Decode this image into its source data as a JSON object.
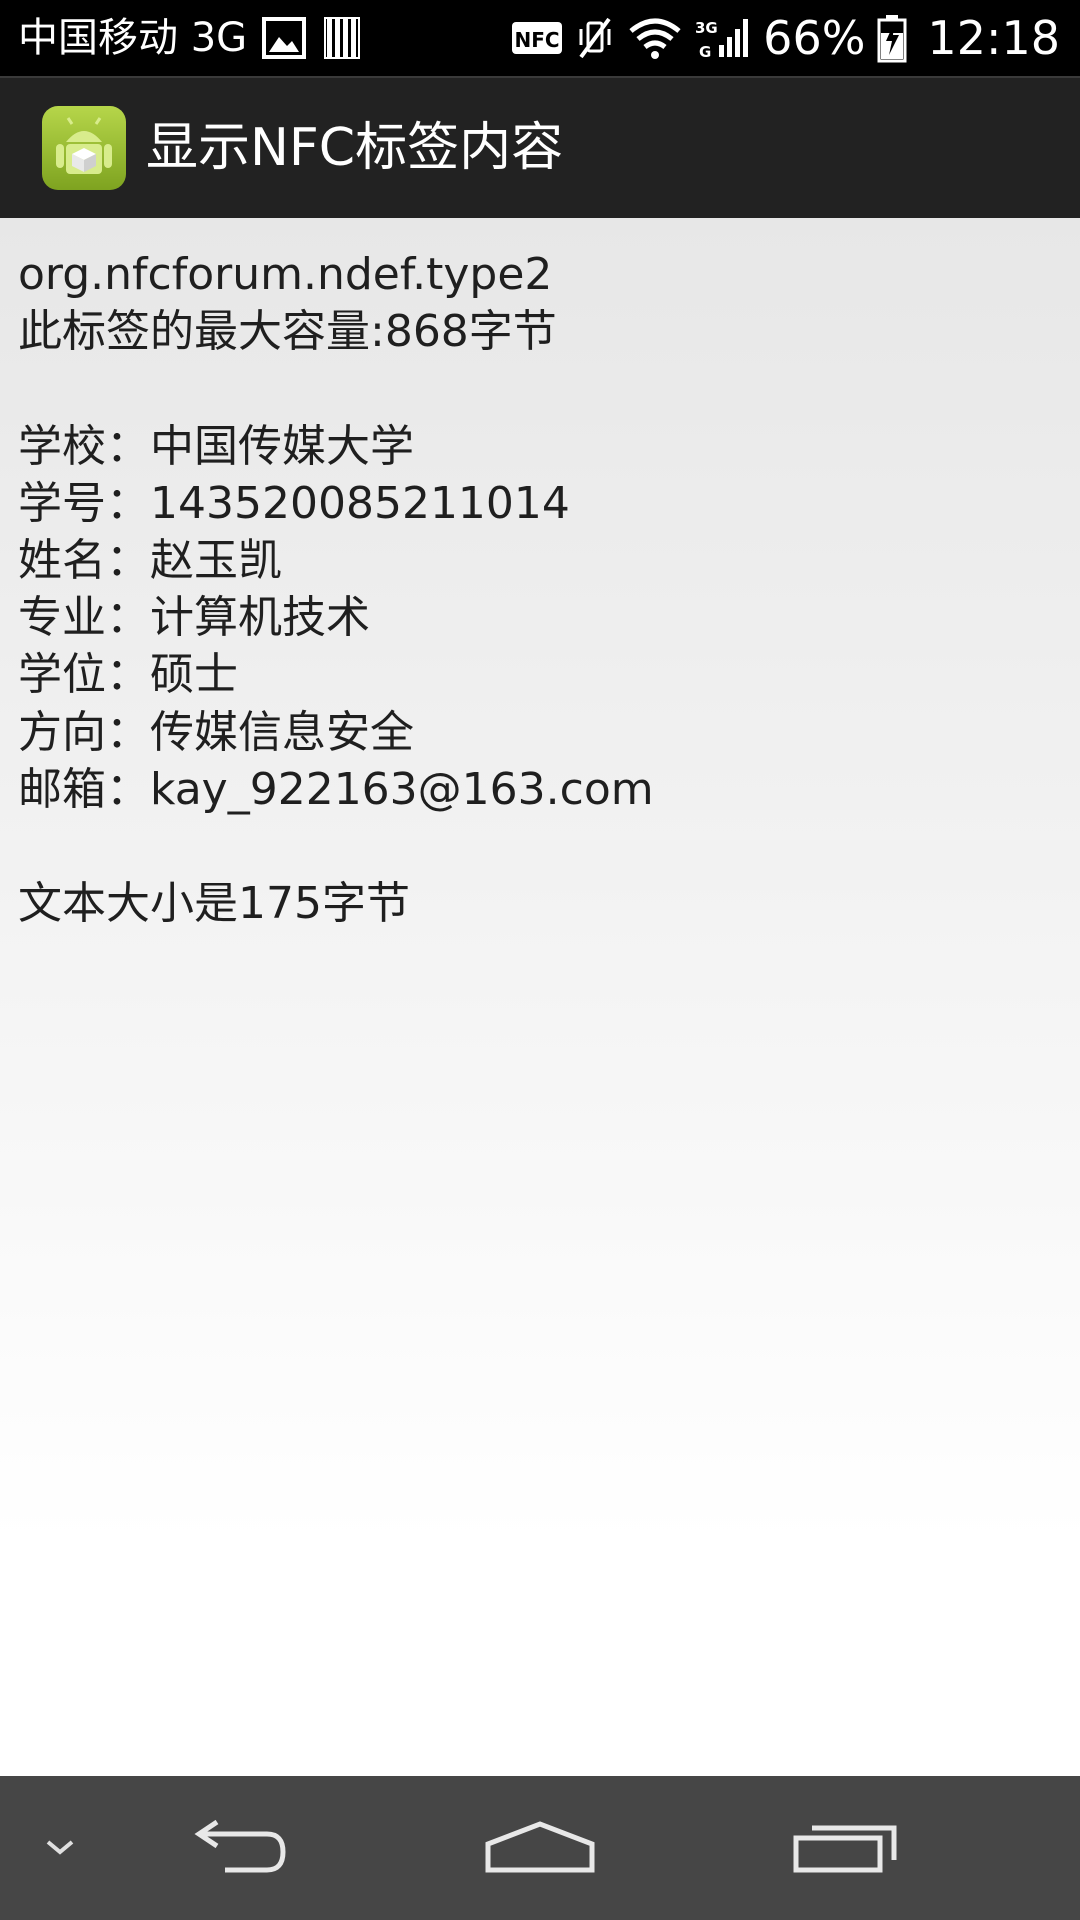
{
  "status_bar": {
    "carrier": "中国移动 3G",
    "battery_percent": "66%",
    "time": "12:18",
    "icons": [
      "image-notification-icon",
      "barcode-notification-icon",
      "nfc-icon",
      "vibrate-icon",
      "wifi-icon",
      "signal-3g-icon",
      "battery-charging-icon"
    ]
  },
  "action_bar": {
    "title": "显示NFC标签内容",
    "icon": "android-app-icon"
  },
  "content": {
    "tag_info": "org.nfcforum.ndef.type2\n此标签的最大容量:868字节\n\n学校：中国传媒大学\n学号：143520085211014\n姓名：赵玉凯\n专业：计算机技术\n学位：硕士\n方向：传媒信息安全\n邮箱：kay_922163@163.com\n\n文本大小是175字节"
  },
  "navigation_bar": {
    "buttons": [
      "hide-chevron-icon",
      "back-icon",
      "home-icon",
      "recent-apps-icon"
    ]
  },
  "colors": {
    "status_bar_bg": "#000000",
    "action_bar_bg": "#222222",
    "nav_bar_bg": "#464646",
    "text": "#1f1f1f"
  }
}
